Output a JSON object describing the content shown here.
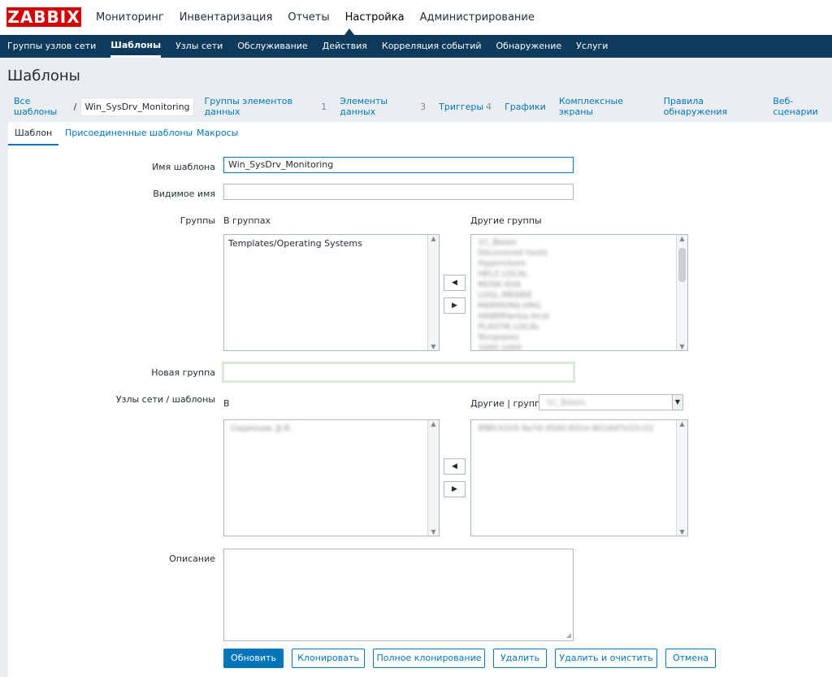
{
  "logo": "ZABBIX",
  "top_menu": [
    "Мониторинг",
    "Инвентаризация",
    "Отчеты",
    "Настройка",
    "Администрирование"
  ],
  "top_menu_active": "Настройка",
  "sub_menu": [
    "Группы узлов сети",
    "Шаблоны",
    "Узлы сети",
    "Обслуживание",
    "Действия",
    "Корреляция событий",
    "Обнаружение",
    "Услуги"
  ],
  "sub_menu_active": "Шаблоны",
  "page_title": "Шаблоны",
  "breadcrumb": {
    "all": "Все шаблоны",
    "sep": "/",
    "current": "Win_SysDrv_Monitoring",
    "links": [
      {
        "label": "Группы элементов данных",
        "count": "1"
      },
      {
        "label": "Элементы данных",
        "count": "3"
      },
      {
        "label": "Триггеры",
        "count": "4"
      },
      {
        "label": "Графики",
        "count": ""
      },
      {
        "label": "Комплексные экраны",
        "count": ""
      },
      {
        "label": "Правила обнаружения",
        "count": ""
      },
      {
        "label": "Веб-сценарии",
        "count": ""
      }
    ]
  },
  "tabs": [
    "Шаблон",
    "Присоединенные шаблоны",
    "Макросы"
  ],
  "form": {
    "template_name_label": "Имя шаблона",
    "template_name_value": "Win_SysDrv_Monitoring",
    "visible_name_label": "Видимое имя",
    "visible_name_value": "",
    "groups_label": "Группы",
    "in_groups_title": "В группах",
    "in_groups_items": [
      "Templates/Operating Systems"
    ],
    "other_groups_title": "Другие группы",
    "other_groups_items": [
      "1С_Bases",
      "Discovered hosts",
      "Hypervisors",
      "HELZ.LOCAL",
      "MOSK.IIGA",
      "LOGL.MEWEE",
      "MARMORA.ORG",
      "HABERlanka.local",
      "PLASTIK.LOCAL",
      "Templates",
      "1000.1000"
    ],
    "new_group_label": "Новая группа",
    "new_group_value": "",
    "hosts_label": "Узлы сети / шаблоны",
    "hosts_in_title": "В",
    "hosts_in_items": [
      "Скрипник Д.В."
    ],
    "hosts_other_title": "Другие | группа",
    "hosts_other_group": "1С_Bases",
    "hosts_other_items": [
      "9f8fc4325-9a7d-4590-831e-8016d7e22c22"
    ],
    "description_label": "Описание",
    "description_value": ""
  },
  "buttons": {
    "update": "Обновить",
    "clone": "Клонировать",
    "full_clone": "Полное клонирование",
    "delete": "Удалить",
    "delete_clear": "Удалить и очистить",
    "cancel": "Отмена"
  },
  "arrows": {
    "left": "◀",
    "right": "▶"
  }
}
